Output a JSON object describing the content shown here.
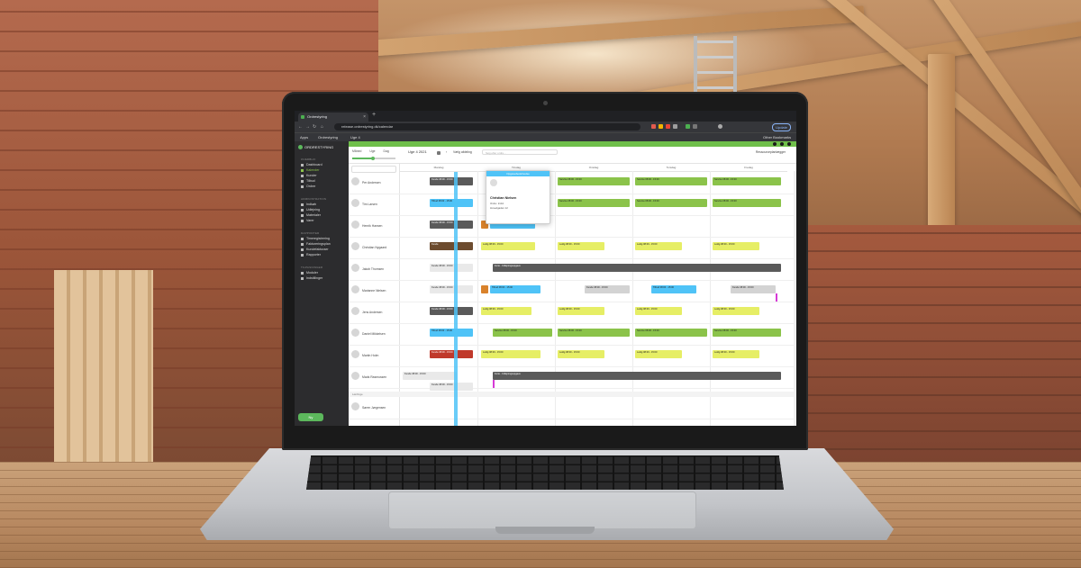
{
  "browser": {
    "tab_title": "Ordrestyring",
    "url": "release.ordrestyring.dk/calendar",
    "update_label": "Update",
    "bookmarks": [
      "Apps",
      "Ordrestyring",
      "Uge 4"
    ],
    "other_bookmarks": "Other Bookmarks"
  },
  "app": {
    "brand": "ORDRESTYRING",
    "new_button": "Ny",
    "sidebar_sections": [
      {
        "title": "OVERBLIK",
        "items": [
          "Dashboard",
          "Kalender",
          "Kunder",
          "Tilbud",
          "Ordrer"
        ]
      },
      {
        "title": "ADMINISTRATION",
        "items": [
          "Indkøb",
          "Udlejning",
          "Materialer",
          "Varer"
        ]
      },
      {
        "title": "RAPPORTER",
        "items": [
          "Timeregistrering",
          "Faktureringsplan",
          "Kundefakturaer",
          "Rapporter"
        ]
      },
      {
        "title": "TILPASNINGER",
        "items": [
          "Moduler",
          "Indstillinger"
        ]
      }
    ],
    "active_item": "Kalender"
  },
  "toolbar": {
    "view_tabs": [
      "Måned",
      "Uge",
      "Dag"
    ],
    "week_title": "Uge 4",
    "week_year": "2021",
    "filter_label": "Vælg afdeling",
    "search_placeholder": "Søg efter ordre…",
    "resource_label": "Ressourceplanlægger"
  },
  "days": [
    "Mandag",
    "Tirsdag",
    "Onsdag",
    "Torsdag",
    "Fredag"
  ],
  "resources": [
    "Per Andersen",
    "Tim Larsen",
    "Henrik Hansen",
    "Christian Nygaard",
    "Jakob Thomsen",
    "Marianne Nielsen",
    "Jens Andersen",
    "Daniel Mikkelsen",
    "Martin Holm",
    "Mads Rasmussen"
  ],
  "popup": {
    "header": "Opgavebeskrivelse",
    "title": "Christian Nielsen",
    "line1": "Ordre: 2144",
    "line2": "Hovedgaden 12"
  },
  "group_label": "Lærlinge",
  "bottom_resource": "Søren Jørgensen",
  "event_labels": {
    "service": "Service",
    "tilbud": "Tilbud",
    "kunde": "Kunde",
    "time": "08:00 - 15:00",
    "tag": "Ledig",
    "long": "Ferie - Udlejningsopgave"
  },
  "colors": {
    "brand_green": "#5cb85c",
    "event_green": "#8bc34a",
    "event_yellow": "#e6ee65",
    "event_dark": "#5a5a5a",
    "event_blue": "#4fc3f7",
    "event_orange": "#d9822b",
    "event_red": "#c0392b",
    "sidebar_bg": "#2c2c2e"
  }
}
